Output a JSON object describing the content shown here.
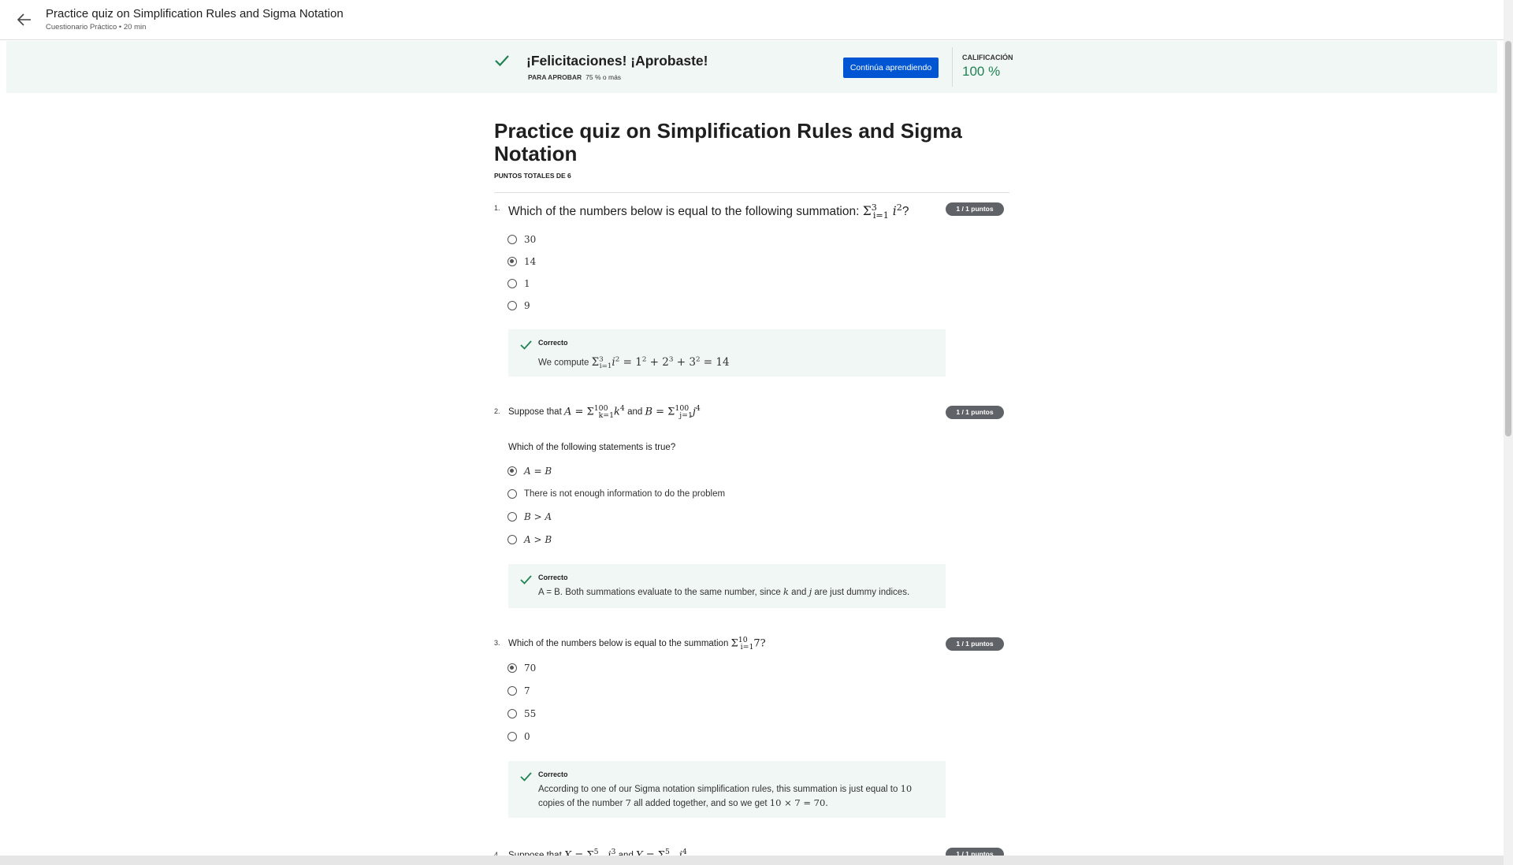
{
  "header": {
    "title": "Practice quiz on Simplification Rules and Sigma Notation",
    "subtitle": "Cuestionario Práctico • 20 min",
    "back_icon": "arrow-left-icon"
  },
  "banner": {
    "title": "¡Felicitaciones! ¡Aprobaste!",
    "pass_label": "PARA APROBAR",
    "pass_value": "75 % o más",
    "continue_label": "Continúa aprendiendo",
    "grade_label": "CALIFICACIÓN",
    "grade_value": "100 %",
    "accent_color": "#1f8354",
    "button_color": "#0056d2"
  },
  "quiz": {
    "title": "Practice quiz on Simplification Rules and Sigma Notation",
    "total_points_label": "PUNTOS TOTALES DE 6"
  },
  "questions": [
    {
      "number": "1.",
      "text_before": "Which of the numbers below is equal to the following summation: ",
      "text_after": "?",
      "points": "1 / 1 puntos",
      "options": [
        "30",
        "14",
        "1",
        "9"
      ],
      "selected": "14",
      "feedback_label": "Correcto",
      "feedback_text": "We compute"
    },
    {
      "number": "2.",
      "text_before": "Suppose that",
      "text_mid": "and",
      "points": "1 / 1 puntos",
      "prompt": "Which of the following statements is true?",
      "options": [
        "A = B",
        "There is not enough information to do the problem",
        "B > A",
        "A > B"
      ],
      "selected": "A = B",
      "feedback_label": "Correcto",
      "feedback_text_a": "A = B. Both summations evaluate to the same number, since",
      "feedback_text_b": "and",
      "feedback_text_c": "are just dummy indices."
    },
    {
      "number": "3.",
      "text_before": "Which of the numbers below is equal to the summation",
      "points": "1 / 1 puntos",
      "options": [
        "70",
        "7",
        "55",
        "0"
      ],
      "selected": "70",
      "feedback_label": "Correcto",
      "feedback_text_a": "According to one of our Sigma notation simplification rules, this summation is just equal to",
      "feedback_text_b": "copies of the number",
      "feedback_text_c": "all added together, and so we get"
    },
    {
      "number": "4.",
      "text_before": "Suppose that",
      "text_mid": "and",
      "points": "1 / 1 puntos"
    }
  ]
}
